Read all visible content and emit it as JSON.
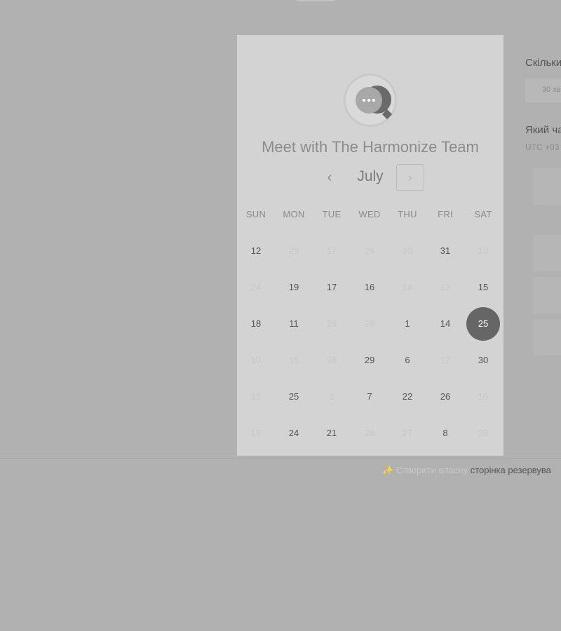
{
  "calendar": {
    "title": "Meet with The Harmonize Team",
    "month": "July",
    "prev_label": "‹",
    "next_label": "›",
    "weekdays": [
      "SUN",
      "MON",
      "TUE",
      "WED",
      "THU",
      "FRI",
      "SAT"
    ],
    "days": [
      [
        {
          "d": "12",
          "on": true
        },
        {
          "d": "29",
          "on": false
        },
        {
          "d": "17",
          "on": false
        },
        {
          "d": "26",
          "on": false
        },
        {
          "d": "10",
          "on": false
        },
        {
          "d": "31",
          "on": true
        },
        {
          "d": "18",
          "on": false
        }
      ],
      [
        {
          "d": "24",
          "on": false
        },
        {
          "d": "19",
          "on": true
        },
        {
          "d": "17",
          "on": true
        },
        {
          "d": "16",
          "on": true
        },
        {
          "d": "14",
          "on": false
        },
        {
          "d": "13",
          "on": false
        },
        {
          "d": "15",
          "on": true
        }
      ],
      [
        {
          "d": "18",
          "on": true
        },
        {
          "d": "11",
          "on": true
        },
        {
          "d": "26",
          "on": false
        },
        {
          "d": "28",
          "on": false
        },
        {
          "d": "1",
          "on": true
        },
        {
          "d": "14",
          "on": true
        },
        {
          "d": "25",
          "on": true,
          "selected": true
        }
      ],
      [
        {
          "d": "10",
          "on": false
        },
        {
          "d": "15",
          "on": false
        },
        {
          "d": "28",
          "on": false
        },
        {
          "d": "29",
          "on": true
        },
        {
          "d": "6",
          "on": true
        },
        {
          "d": "17",
          "on": false
        },
        {
          "d": "30",
          "on": true
        }
      ],
      [
        {
          "d": "15",
          "on": false
        },
        {
          "d": "25",
          "on": true
        },
        {
          "d": "2",
          "on": false
        },
        {
          "d": "7",
          "on": true
        },
        {
          "d": "22",
          "on": true
        },
        {
          "d": "26",
          "on": true
        },
        {
          "d": "15",
          "on": false
        }
      ],
      [
        {
          "d": "18",
          "on": false
        },
        {
          "d": "24",
          "on": true
        },
        {
          "d": "21",
          "on": true
        },
        {
          "d": "28",
          "on": false
        },
        {
          "d": "27",
          "on": false
        },
        {
          "d": "8",
          "on": true
        },
        {
          "d": "28",
          "on": false
        }
      ]
    ]
  },
  "side": {
    "duration_label": "Скільки",
    "duration_value": "30 хв",
    "time_label": "Який ча",
    "timezone": "UTC +03"
  },
  "footer": {
    "sparkle": "✨",
    "prefix": "Створити власну",
    "link": "сторінка резервува"
  },
  "colors": {
    "background": "#b1b1b1",
    "card": "#d3d3d3",
    "selected_day": "#666666",
    "available_day": "#555555",
    "unavailable_day": "#c8c8c8"
  }
}
